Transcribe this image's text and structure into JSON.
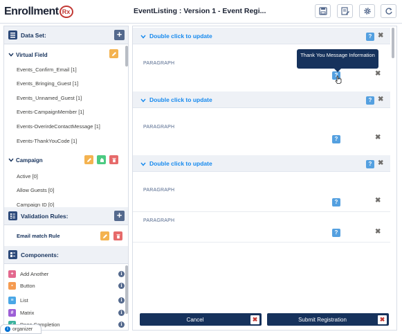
{
  "header": {
    "logo_text": "Enrollment",
    "logo_badge": "Rx",
    "title": "EventListing : Version 1 - Event Regi...",
    "buttons": [
      "save-icon",
      "edit-icon",
      "gear-icon",
      "refresh-icon"
    ]
  },
  "left_panel": {
    "dataset": {
      "title": "Data Set:",
      "groups": [
        {
          "label": "Virtual Field",
          "items": [
            "Events_Confirm_Email [1]",
            "Events_Bringing_Guest [1]",
            "Events_Unnamed_Guest [1]",
            "Events-CampaignMember [1]",
            "Events-OverirdeContactMessage [1]",
            "Events-ThankYouCode [1]"
          ]
        },
        {
          "label": "Campaign",
          "items": [
            "Active [0]",
            "Allow Guests [0]",
            "Campaign ID [0]"
          ]
        }
      ]
    },
    "validation": {
      "title": "Validation Rules:",
      "rule": "Email match Rule"
    },
    "components": {
      "title": "Components:",
      "items": [
        {
          "label": "Add Another",
          "color": "#e3688e"
        },
        {
          "label": "Button",
          "color": "#f59b51"
        },
        {
          "label": "List",
          "color": "#4aa7e6"
        },
        {
          "label": "Matrix",
          "color": "#9d5fd6"
        },
        {
          "label": "Page Completion",
          "color": "#3cb39e"
        }
      ]
    },
    "organizer_label": "organizer"
  },
  "main": {
    "blocks": [
      {
        "title": "Double click to update",
        "rows": [
          "PARAGRAPH"
        ]
      },
      {
        "title": "Double click to update",
        "rows": [
          "PARAGRAPH"
        ]
      },
      {
        "title": "Double click to update",
        "rows": [
          "PARAGRAPH",
          "PARAGRAPH"
        ]
      }
    ],
    "tooltip": "Thank You Message Information",
    "cancel_label": "Cancel",
    "submit_label": "Submit Registration"
  },
  "colors": {
    "navy": "#16325c",
    "link_blue": "#1589ee",
    "help_blue": "#54a0e0",
    "edit_orange": "#f4b350",
    "delete_red": "#e66a6a",
    "clone_green": "#4bca81"
  }
}
